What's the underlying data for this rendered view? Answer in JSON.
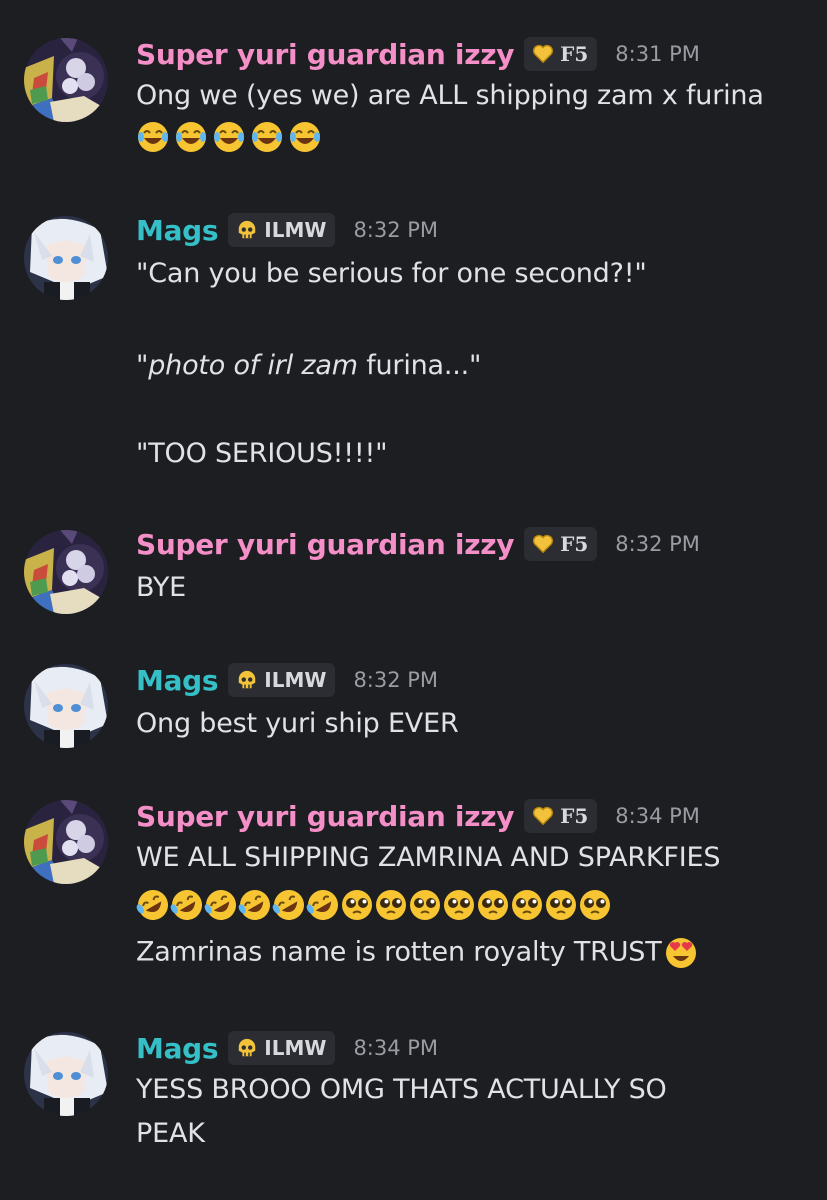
{
  "users": {
    "izzy": {
      "name": "Super yuri guardian izzy",
      "tag": "F5",
      "tag_icon": "gold-heart-icon",
      "color": "#f58fc7"
    },
    "mags": {
      "name": "Mags",
      "tag": "ILMW",
      "tag_icon": "skull-icon",
      "color": "#35c0c8"
    }
  },
  "messages": [
    {
      "author": "izzy",
      "time": "8:31 PM",
      "lines": [
        "Ong we (yes we) are ALL shipping zam x furina"
      ],
      "emoji_rows": [
        [
          "joy",
          "joy",
          "joy",
          "joy",
          "joy"
        ]
      ]
    },
    {
      "author": "mags",
      "time": "8:32 PM",
      "lines": [
        "\"Can you be serious for one second?!\"",
        "",
        "\"",
        "photo of irl zam",
        " furina...\"",
        "",
        "\"TOO SERIOUS!!!!\""
      ]
    },
    {
      "author": "izzy",
      "time": "8:32 PM",
      "lines": [
        "BYE"
      ]
    },
    {
      "author": "mags",
      "time": "8:32 PM",
      "lines": [
        "Ong best yuri ship EVER"
      ]
    },
    {
      "author": "izzy",
      "time": "8:34 PM",
      "lines": [
        "WE ALL SHIPPING ZAMRINA AND SPARKFIES",
        "Zamrinas name is rotten royalty TRUST"
      ],
      "emoji_rows": [
        [
          "rofl",
          "rofl",
          "rofl",
          "rofl",
          "rofl",
          "rofl",
          "pleading",
          "pleading",
          "pleading",
          "pleading",
          "pleading",
          "pleading",
          "pleading",
          "pleading"
        ]
      ],
      "trailing_emoji": "heart-eyes"
    },
    {
      "author": "mags",
      "time": "8:34 PM",
      "lines": [
        "YESS BROOO OMG THATS ACTUALLY SO",
        "PEAK"
      ]
    }
  ]
}
